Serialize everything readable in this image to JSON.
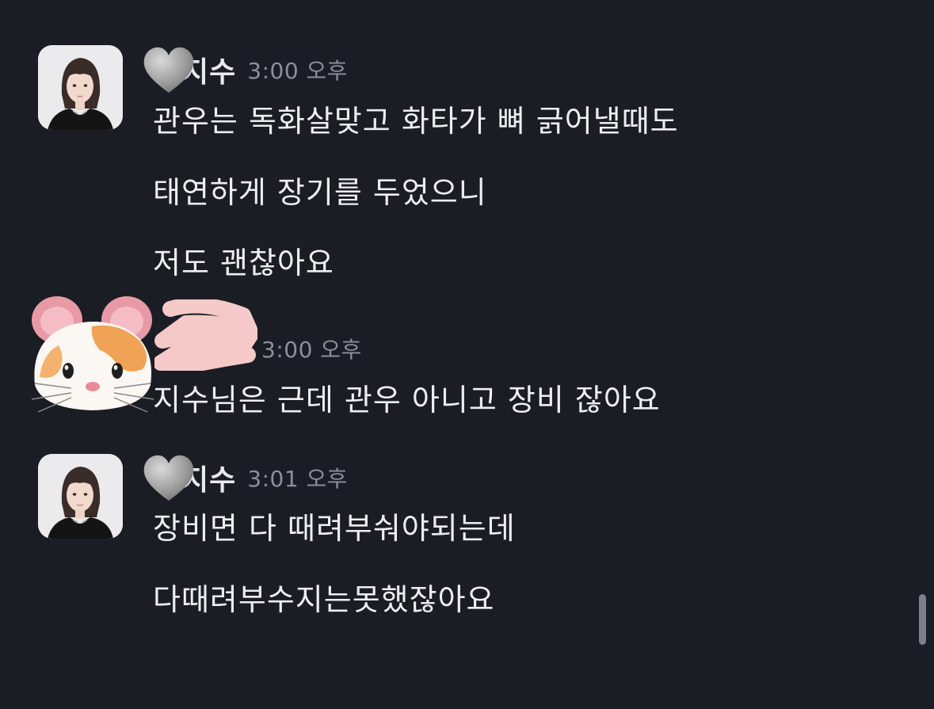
{
  "messages": [
    {
      "sender": "지수",
      "time": "3:00 오후",
      "lines": [
        "관우는 독화살맞고 화타가 뼈 긁어낼때도",
        "태연하게 장기를 두었으니",
        "저도 괜찮아요"
      ]
    },
    {
      "sender": "",
      "time": "3:00 오후",
      "lines": [
        "지수님은 근데 관우 아니고 장비 잖아요"
      ]
    },
    {
      "sender": "지수",
      "time": "3:01 오후",
      "lines": [
        "장비면 다 때려부숴야되는데",
        "다때려부수지는못했잖아요"
      ]
    }
  ],
  "icons": {
    "heart": "grey-heart-icon",
    "hamster": "hamster-face-emoji",
    "redaction": "pink-scribble-redaction"
  },
  "colors": {
    "background": "#1a1d24",
    "text": "#eceef2",
    "timestamp": "#8b8f99",
    "redaction": "#f6c9c9"
  }
}
